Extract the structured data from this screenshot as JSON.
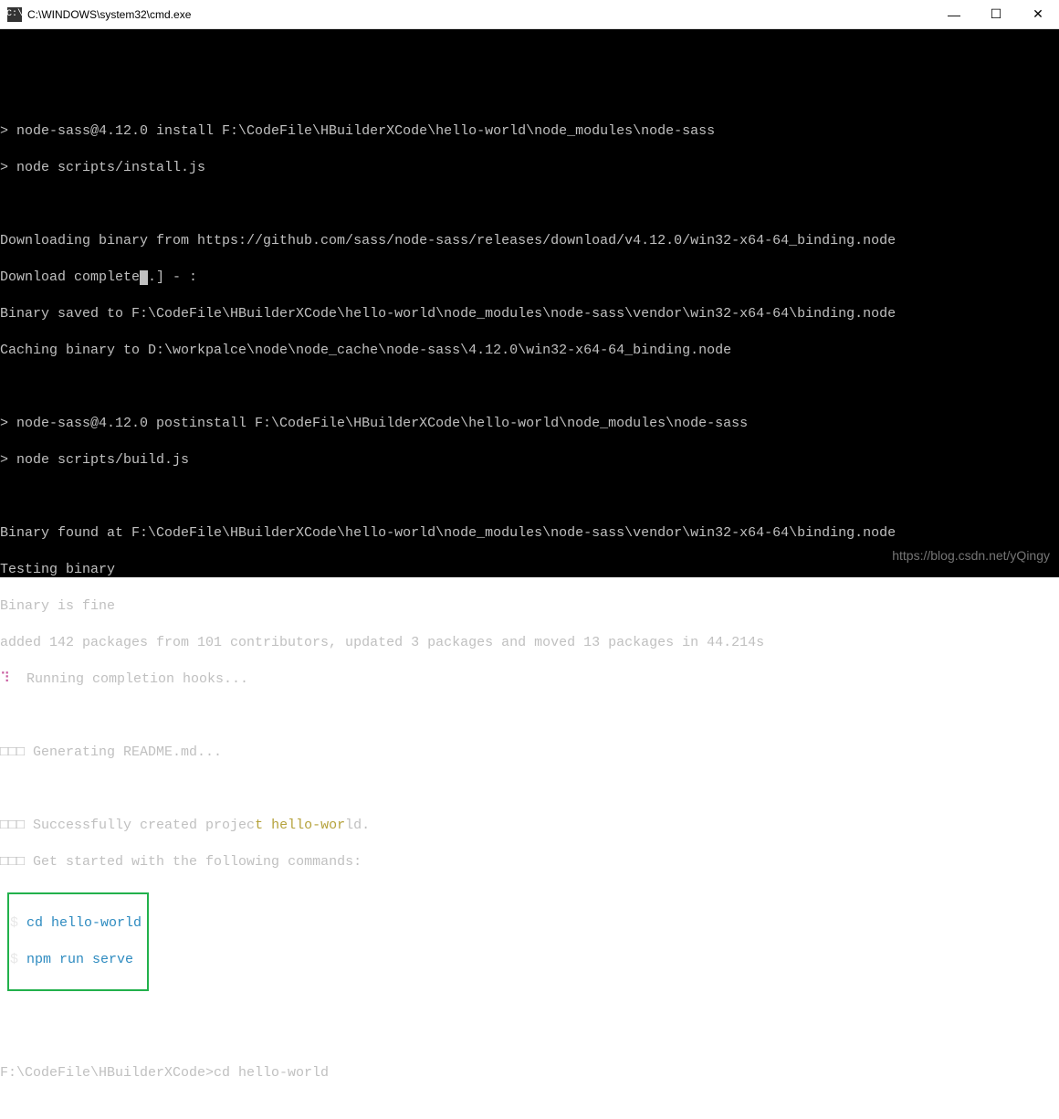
{
  "window": {
    "title": "C:\\WINDOWS\\system32\\cmd.exe",
    "icon_label": "C:\\"
  },
  "controls": {
    "minimize": "—",
    "maximize": "☐",
    "close": "✕"
  },
  "lines": {
    "l1": "> node-sass@4.12.0 install F:\\CodeFile\\HBuilderXCode\\hello-world\\node_modules\\node-sass",
    "l2": "> node scripts/install.js",
    "l3": "Downloading binary from https://github.com/sass/node-sass/releases/download/v4.12.0/win32-x64-64_binding.node",
    "l4a": "Download complete",
    "l4b": ".] - :",
    "l5": "Binary saved to F:\\CodeFile\\HBuilderXCode\\hello-world\\node_modules\\node-sass\\vendor\\win32-x64-64\\binding.node",
    "l6": "Caching binary to D:\\workpalce\\node\\node_cache\\node-sass\\4.12.0\\win32-x64-64_binding.node",
    "l7": "> node-sass@4.12.0 postinstall F:\\CodeFile\\HBuilderXCode\\hello-world\\node_modules\\node-sass",
    "l8": "> node scripts/build.js",
    "l9": "Binary found at F:\\CodeFile\\HBuilderXCode\\hello-world\\node_modules\\node-sass\\vendor\\win32-x64-64\\binding.node",
    "l10": "Testing binary",
    "l11": "Binary is fine",
    "l12": "added 142 packages from 101 contributors, updated 3 packages and moved 13 packages in 44.214s",
    "l13a": "⠹",
    "l13b": "  Running completion hooks...",
    "l14a": "□□□",
    "l14b": " Generating README.md...",
    "l15a": "□□□",
    "l15b": " Successfully created projec",
    "l15c": "t hello-wor",
    "l15d": "ld.",
    "l16a": "□□□",
    "l16b": " Get started with the following commands:",
    "cmd1a": "$",
    "cmd1b": " cd hello-world",
    "cmd2a": "$",
    "cmd2b": " npm run serve",
    "l17": "F:\\CodeFile\\HBuilderXCode>cd hello-world"
  },
  "watermark": "https://blog.csdn.net/yQingy"
}
